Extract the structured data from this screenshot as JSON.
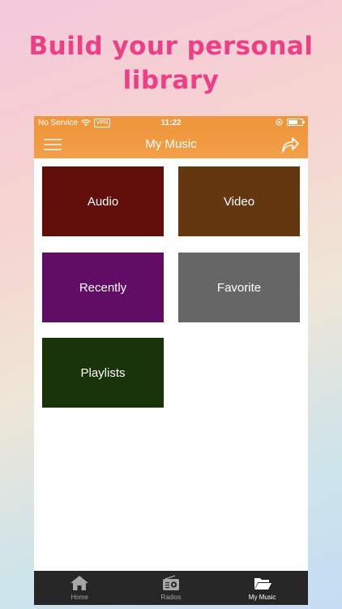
{
  "headline": {
    "line1": "Build your personal",
    "line2": "library"
  },
  "status_bar": {
    "carrier": "No Service",
    "vpn": "VPN",
    "time": "11:22",
    "battery_level": 0.7
  },
  "nav": {
    "title": "My Music"
  },
  "tiles": [
    {
      "label": "Audio",
      "color": "#620e0a"
    },
    {
      "label": "Video",
      "color": "#633811"
    },
    {
      "label": "Recently",
      "color": "#600e65"
    },
    {
      "label": "Favorite",
      "color": "#666666"
    },
    {
      "label": "Playlists",
      "color": "#183408"
    }
  ],
  "tabs": [
    {
      "label": "Home",
      "icon": "home-icon",
      "active": false
    },
    {
      "label": "Radios",
      "icon": "radio-icon",
      "active": false
    },
    {
      "label": "My Music",
      "icon": "folder-icon",
      "active": true
    }
  ],
  "colors": {
    "accent": "#ef973d",
    "headline": "#ee3e86",
    "tabbar": "#262626"
  }
}
